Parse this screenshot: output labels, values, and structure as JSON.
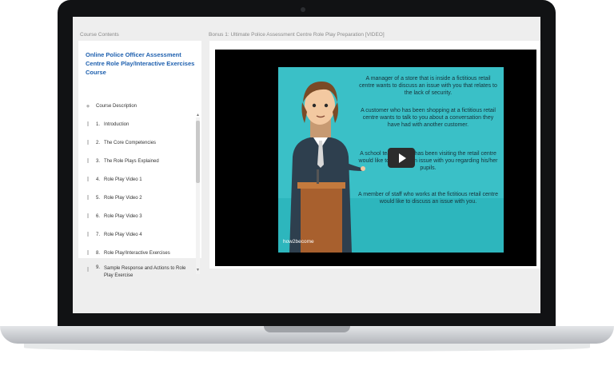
{
  "left_panel": {
    "heading": "Course Contents",
    "course_title": "Online Police Officer Assessment Centre Role Play/Interactive Exercises Course",
    "items": [
      {
        "num": "",
        "label": "Course Description"
      },
      {
        "num": "1.",
        "label": "Introduction"
      },
      {
        "num": "2.",
        "label": "The Core Competencies"
      },
      {
        "num": "3.",
        "label": "The Role Plays Explained"
      },
      {
        "num": "4.",
        "label": "Role Play Video 1"
      },
      {
        "num": "5.",
        "label": "Role Play Video 2"
      },
      {
        "num": "6.",
        "label": "Role Play Video 3"
      },
      {
        "num": "7.",
        "label": "Role Play Video 4"
      },
      {
        "num": "8.",
        "label": "Role Play/Interactive Exercises"
      },
      {
        "num": "9.",
        "label": "Sample Response and Actions to Role Play Exercise"
      }
    ]
  },
  "video": {
    "heading": "Bonus 1: Ultimate Police Assessment Centre Role Play Preparation [VIDEO]",
    "slide_texts": [
      "A manager of a store that is inside a fictitious retail centre wants to discuss an issue with you that relates to the lack of security.",
      "A customer who has been shopping at a fictitious retail centre wants to talk to you about a conversation they have had with another customer.",
      "A school teacher who has been visiting the retail centre would like to discuss an issue with you regarding his/her pupils.",
      "A member of staff who works at the fictitious retail centre would like to discuss an issue with you."
    ],
    "logo": "how2become"
  },
  "colors": {
    "accent": "#1d5fae",
    "slide_bg": "#3ac0c7",
    "lid": "#111214"
  }
}
